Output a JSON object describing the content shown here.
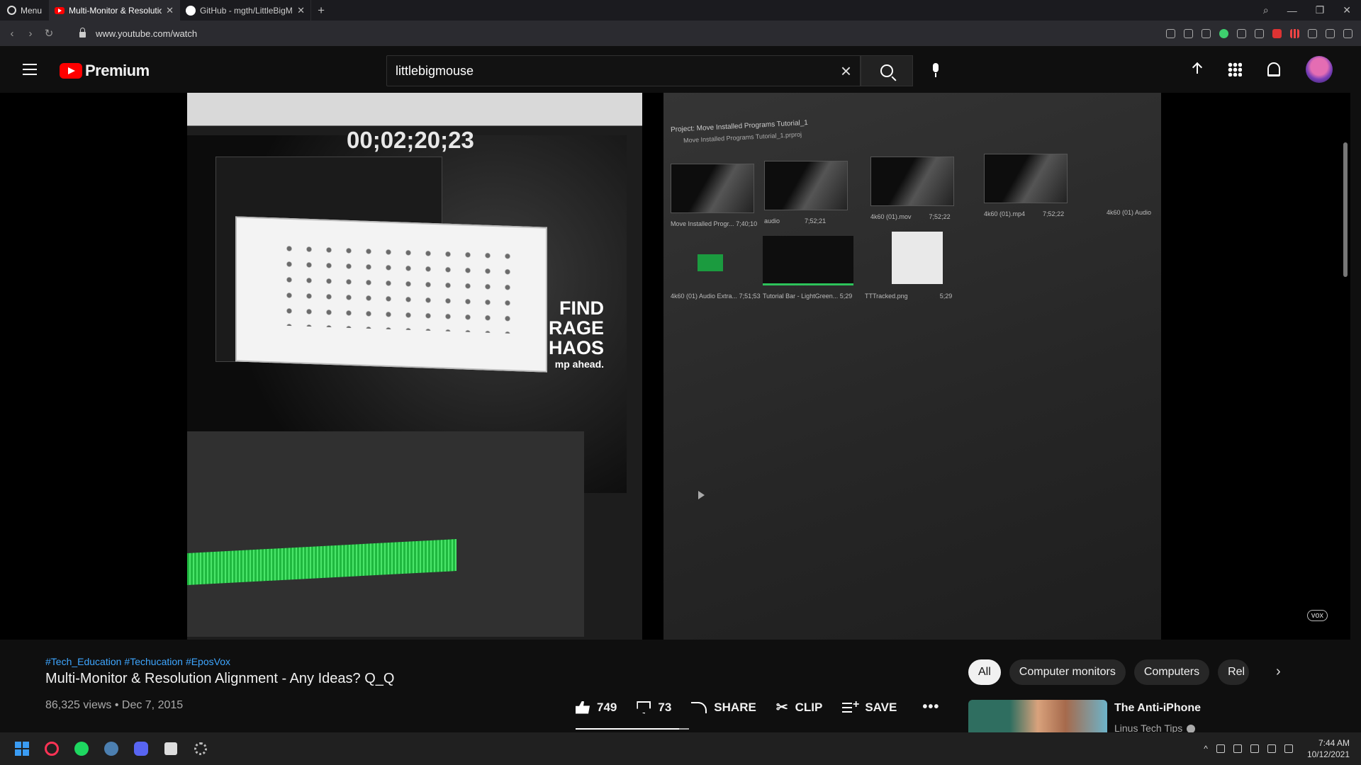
{
  "browser": {
    "menu_label": "Menu",
    "tabs": [
      {
        "label": "Multi-Monitor & Resolutio",
        "icon": "youtube-favicon",
        "active": true
      },
      {
        "label": "GitHub - mgth/LittleBigMo",
        "icon": "github-favicon",
        "active": false
      }
    ],
    "new_tab": "+",
    "url": "www.youtube.com/watch"
  },
  "youtube": {
    "logo_text": "Premium",
    "search_value": "littlebigmouse"
  },
  "player": {
    "timecode": "00;02;20;23",
    "slogan_lines": [
      "FIND",
      "RAGE",
      "HAOS"
    ],
    "slogan_small": "mp ahead.",
    "project_title": "Project: Move Installed Programs Tutorial_1",
    "project_file": "Move Installed Programs Tutorial_1.prproj",
    "bin_items": [
      {
        "name": "Move Installed Progr...",
        "duration": "7;40;10"
      },
      {
        "name": "audio",
        "duration": "7;52;21"
      },
      {
        "name": "4k60 (01).mov",
        "duration": "7;52;22"
      },
      {
        "name": "4k60 (01).mp4",
        "duration": "7;52;22"
      },
      {
        "name": "4k60 (01) Audio",
        "duration": ""
      },
      {
        "name": "4k60 (01) Audio Extra...",
        "duration": "7;51;53"
      },
      {
        "name": "Tutorial Bar - LightGreen...",
        "duration": "5;29"
      },
      {
        "name": "TTTracked.png",
        "duration": "5;29"
      }
    ],
    "watermark": "vox"
  },
  "video": {
    "hashtags": [
      "#Tech_Education",
      "#Techucation",
      "#EposVox"
    ],
    "title": "Multi-Monitor & Resolution Alignment - Any Ideas? Q_Q",
    "meta": "86,325 views • Dec 7, 2015",
    "likes": "749",
    "dislikes": "73",
    "like_ratio": 0.91,
    "share_label": "SHARE",
    "clip_label": "CLIP",
    "save_label": "SAVE"
  },
  "sidebar": {
    "chips": [
      "All",
      "Computer monitors",
      "Computers",
      "Rel"
    ],
    "recommendation": {
      "title": "The Anti-iPhone",
      "channel": "Linus Tech Tips"
    }
  },
  "taskbar": {
    "time": "7:44 AM",
    "date": "10/12/2021"
  }
}
